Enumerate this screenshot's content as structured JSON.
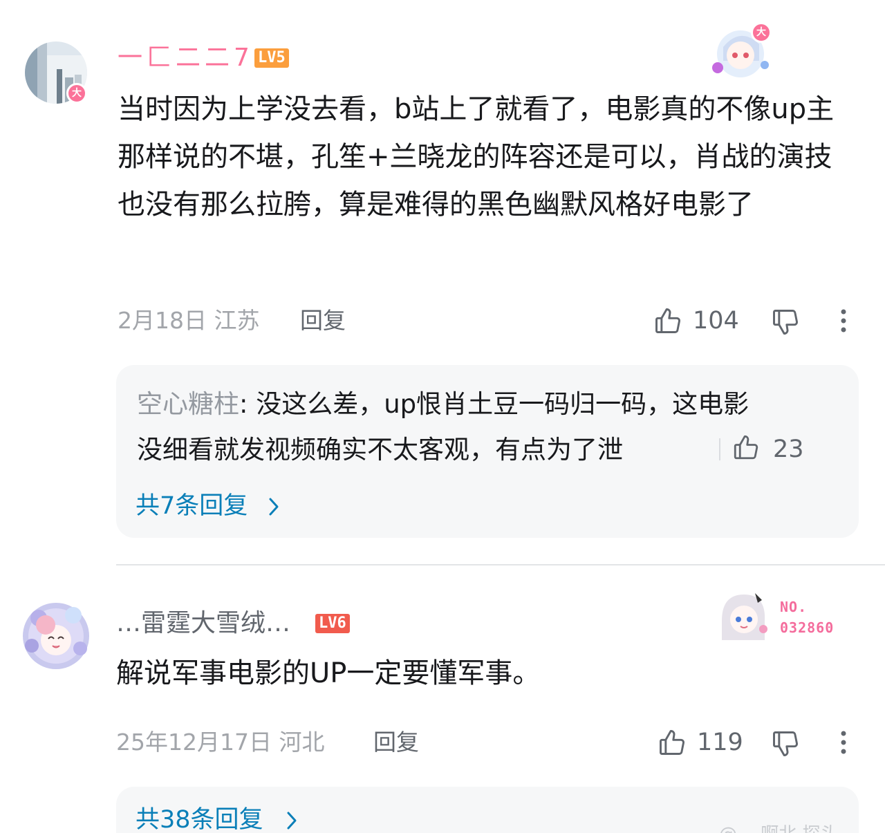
{
  "colors": {
    "username_pink": "#fb7299",
    "username_gray": "#61666d",
    "level5": "#fb9e3d",
    "level6": "#f15b4d",
    "link_blue": "#0a7fb8",
    "meta_gray": "#a2a5aa",
    "subbox_bg": "#f6f7f8"
  },
  "comments": [
    {
      "username": "一匚二二7",
      "level": "LV5",
      "vip_badge": "大",
      "content": "当时因为上学没去看，b站上了就看了，电影真的不像up主那样说的不堪，孔笙+兰晓龙的阵容还是可以，肖战的演技也没有那么拉胯，算是难得的黑色幽默风格好电影了",
      "date_location": "2月18日 江苏",
      "reply_label": "回复",
      "likes": "104",
      "decoration_badge": "大",
      "sub_reply": {
        "user": "空心糖柱",
        "separator": ": ",
        "line1": "没这么差，up恨肖土豆一码归一码，这电影",
        "line2": "没细看就发视频确实不太客观，有点为了泄",
        "likes": "23"
      },
      "more_replies": "共7条回复"
    },
    {
      "username": "…雷霆大雪绒…",
      "level": "LV6",
      "content": "解说军事电影的UP一定要懂军事。",
      "date_location": "25年12月17日 河北",
      "reply_label": "回复",
      "likes": "119",
      "nft": {
        "label": "NO.",
        "number": "032860"
      },
      "more_replies": "共38条回复"
    }
  ],
  "icons": {
    "like": "thumbs-up-icon",
    "dislike": "thumbs-down-icon",
    "more": "more-vertical-icon",
    "chevron": "chevron-right-icon"
  },
  "watermark": "@… 啊北 探头"
}
